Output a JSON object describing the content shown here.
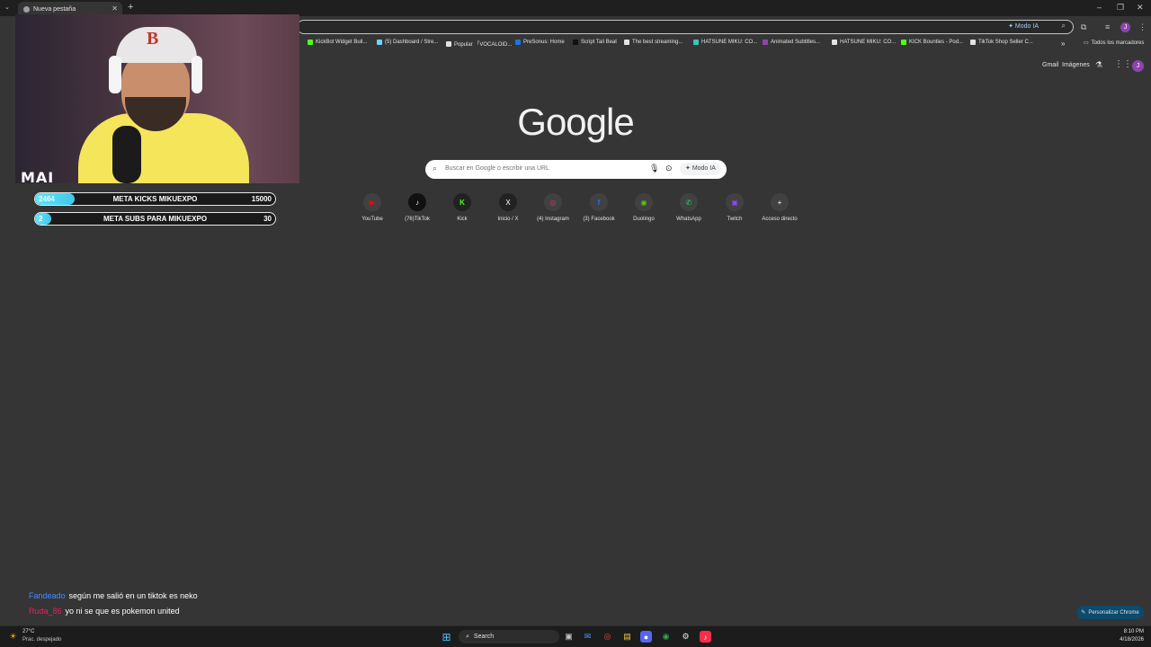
{
  "browser": {
    "tab_title": "Nueva pestaña",
    "omnibox_mode": "Modo IA"
  },
  "bookmarks": [
    {
      "label": "KickBot Widget Buil...",
      "color": "#53fc18"
    },
    {
      "label": "(5) Dashboard / Stre...",
      "color": "#6cd4ff"
    },
    {
      "label": "Popular 「VOCALOID...",
      "color": "#e3e3e3"
    },
    {
      "label": "PreSonus: Home",
      "color": "#1a73e8"
    },
    {
      "label": "Script Tail Beat",
      "color": "#000000"
    },
    {
      "label": "The best streaming...",
      "color": "#e3e3e3"
    },
    {
      "label": "HATSUNE MIKU: CO...",
      "color": "#39c5bb"
    },
    {
      "label": "Animated Subtitles...",
      "color": "#8e44ad"
    },
    {
      "label": "HATSUNE MIKU: CO...",
      "color": "#e3e3e3"
    },
    {
      "label": "KICK Bounties - Pod...",
      "color": "#53fc18"
    },
    {
      "label": "TikTok Shop Seller C...",
      "color": "#e3e3e3"
    }
  ],
  "bookmarks_all": "Todos los marcadores",
  "google": {
    "gmail": "Gmail",
    "images": "Imágenes",
    "avatar_letter": "J",
    "logo": "Google",
    "search_placeholder": "Buscar en Google o escribir una URL",
    "ai_mode": "Modo IA",
    "shortcuts": [
      {
        "label": "YouTube",
        "glyph": "▶",
        "color": "#ff0000"
      },
      {
        "label": "(76)TikTok",
        "glyph": "♪",
        "color": "#000000"
      },
      {
        "label": "Kick",
        "glyph": "K",
        "color": "#53fc18"
      },
      {
        "label": "Inicio / X",
        "glyph": "X",
        "color": "#000000"
      },
      {
        "label": "(4) Instagram",
        "glyph": "◎",
        "color": "#e1306c"
      },
      {
        "label": "(3) Facebook",
        "glyph": "f",
        "color": "#1877f2"
      },
      {
        "label": "Duolingo",
        "glyph": "◉",
        "color": "#58cc02"
      },
      {
        "label": "WhatsApp",
        "glyph": "✆",
        "color": "#25d366"
      },
      {
        "label": "Twitch",
        "glyph": "▣",
        "color": "#9146ff"
      },
      {
        "label": "Acceso directo",
        "glyph": "+",
        "color": "#414141"
      }
    ],
    "personalize": "Personalizar Chrome"
  },
  "overlay": {
    "watermark": "MAI",
    "goals": [
      {
        "current": "2464",
        "title": "META KICKS MIKUEXPO",
        "target": "15000",
        "progress": 0.164
      },
      {
        "current": "2",
        "title": "META SUBS PARA MIKUEXPO",
        "target": "30",
        "progress": 0.067
      }
    ],
    "chat": [
      {
        "user": "Fandeado",
        "user_color": "#4a8cff",
        "message": "según me salió en un tiktok es neko"
      },
      {
        "user": "Ruda_86",
        "user_color": "#e0245e",
        "message": "yo ni se que es pokemon united"
      }
    ]
  },
  "taskbar": {
    "weather_temp": "27°C",
    "weather_desc": "Prac. despejado",
    "search": "Search",
    "time": "8:10 PM",
    "date": "4/18/2026"
  }
}
